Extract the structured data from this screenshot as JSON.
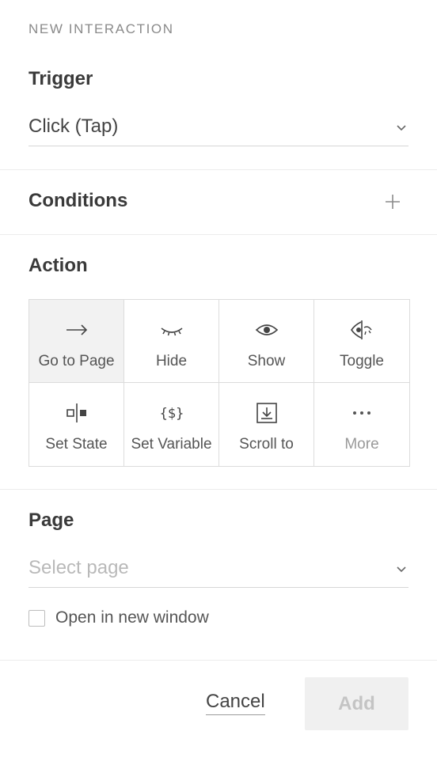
{
  "panel": {
    "title": "NEW INTERACTION"
  },
  "trigger": {
    "heading": "Trigger",
    "value": "Click (Tap)"
  },
  "conditions": {
    "heading": "Conditions"
  },
  "action": {
    "heading": "Action",
    "selected": "Go to Page",
    "options": [
      {
        "label": "Go to Page",
        "icon": "arrow-right-icon"
      },
      {
        "label": "Hide",
        "icon": "eye-closed-icon"
      },
      {
        "label": "Show",
        "icon": "eye-icon"
      },
      {
        "label": "Toggle",
        "icon": "eye-toggle-icon"
      },
      {
        "label": "Set State",
        "icon": "set-state-icon"
      },
      {
        "label": "Set Variable",
        "icon": "variable-icon"
      },
      {
        "label": "Scroll to",
        "icon": "scroll-to-icon"
      },
      {
        "label": "More",
        "icon": "more-dots-icon"
      }
    ]
  },
  "page": {
    "heading": "Page",
    "placeholder": "Select page",
    "open_new_window_label": "Open in new window",
    "open_new_window_checked": false
  },
  "footer": {
    "cancel_label": "Cancel",
    "add_label": "Add"
  },
  "colors": {
    "text": "#333333",
    "muted": "#999999",
    "divider": "#ececec",
    "selected_bg": "#f2f2f2",
    "disabled_bg": "#f0f0f0"
  }
}
